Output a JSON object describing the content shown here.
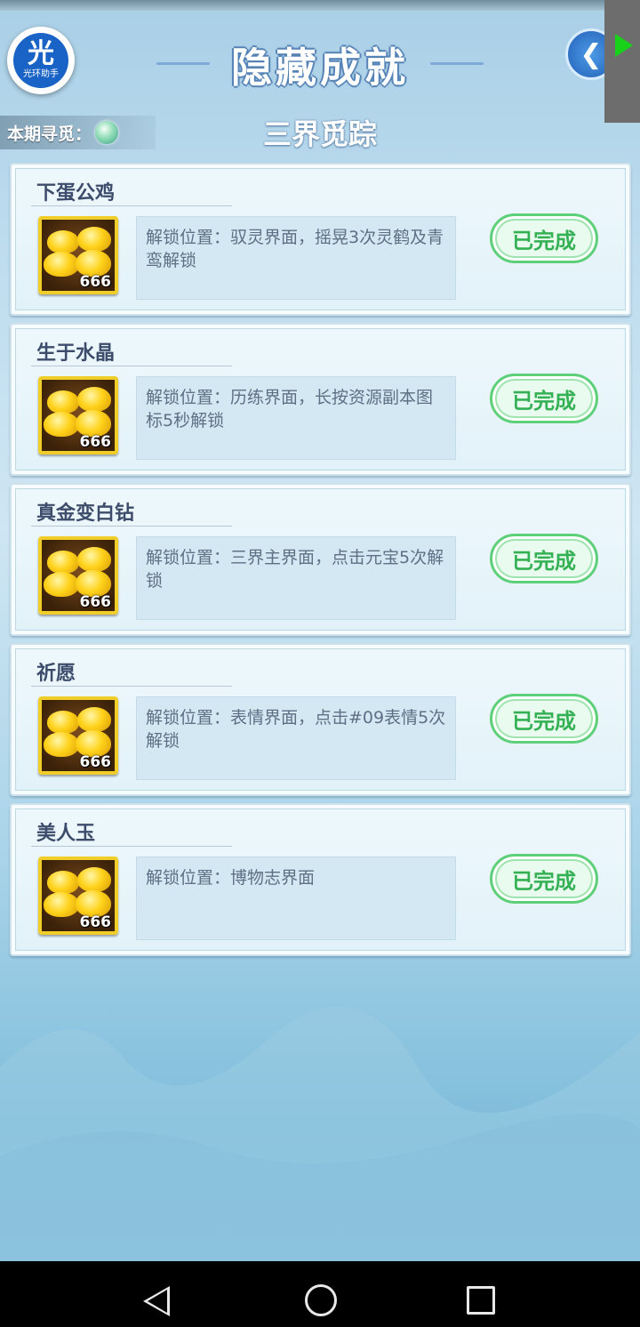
{
  "header": {
    "logo_char": "光",
    "logo_caption": "光环助手",
    "title": "隐藏成就",
    "back_icon": "back-arrow-icon",
    "period_label": "本期寻觅：",
    "subtitle": "三界觅踪"
  },
  "achievements": [
    {
      "name": "下蛋公鸡",
      "reward_count": "666",
      "description": "解锁位置：驭灵界面，摇晃3次灵鹤及青鸾解锁",
      "status": "已完成"
    },
    {
      "name": "生于水晶",
      "reward_count": "666",
      "description": "解锁位置：历练界面，长按资源副本图标5秒解锁",
      "status": "已完成"
    },
    {
      "name": "真金变白钻",
      "reward_count": "666",
      "description": "解锁位置：三界主界面，点击元宝5次解锁",
      "status": "已完成"
    },
    {
      "name": "祈愿",
      "reward_count": "666",
      "description": "解锁位置：表情界面，点击#09表情5次解锁",
      "status": "已完成"
    },
    {
      "name": "美人玉",
      "reward_count": "666",
      "description": "解锁位置：博物志界面",
      "status": "已完成"
    }
  ],
  "colors": {
    "done_text": "#35b155",
    "card_title": "#3d4c6b",
    "desc_text": "#5e6f86",
    "title_stroke": "#5b86b8"
  }
}
